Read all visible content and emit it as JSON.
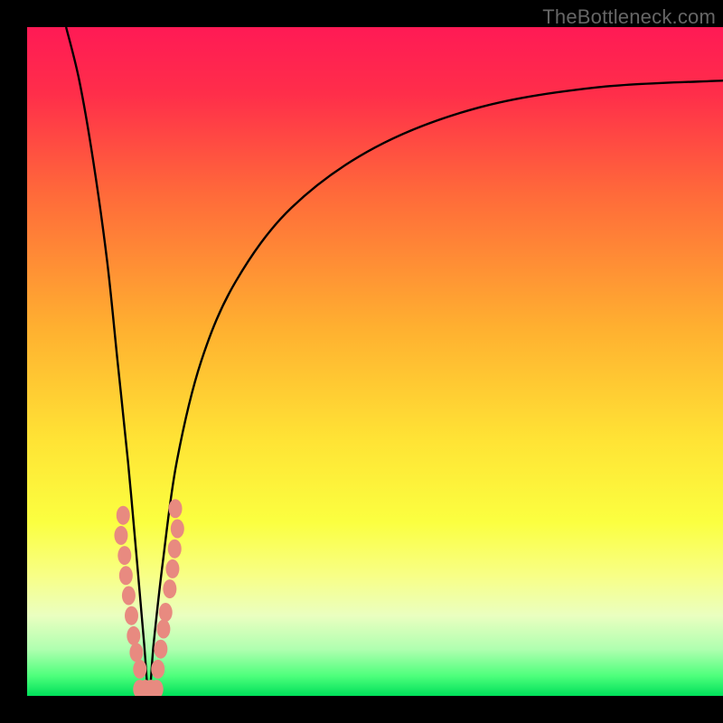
{
  "watermark": "TheBottleneck.com",
  "chart_data": {
    "type": "line",
    "title": "",
    "xlabel": "",
    "ylabel": "",
    "xlim": [
      0,
      100
    ],
    "ylim": [
      0,
      100
    ],
    "gradient_stops": [
      {
        "offset": 0,
        "color": "#ff1a55"
      },
      {
        "offset": 0.1,
        "color": "#ff2e4a"
      },
      {
        "offset": 0.25,
        "color": "#ff6a3a"
      },
      {
        "offset": 0.45,
        "color": "#ffb030"
      },
      {
        "offset": 0.62,
        "color": "#ffe435"
      },
      {
        "offset": 0.74,
        "color": "#fbff40"
      },
      {
        "offset": 0.82,
        "color": "#f8ff86"
      },
      {
        "offset": 0.88,
        "color": "#eaffc0"
      },
      {
        "offset": 0.93,
        "color": "#b0ffb0"
      },
      {
        "offset": 0.97,
        "color": "#4eff7c"
      },
      {
        "offset": 1.0,
        "color": "#00e05a"
      }
    ],
    "curve": {
      "dip_x": 17.5,
      "points": [
        {
          "x": 5.6,
          "y": 100
        },
        {
          "x": 7.5,
          "y": 92
        },
        {
          "x": 9.5,
          "y": 80
        },
        {
          "x": 11.5,
          "y": 65
        },
        {
          "x": 13.0,
          "y": 50
        },
        {
          "x": 14.5,
          "y": 35
        },
        {
          "x": 15.8,
          "y": 20
        },
        {
          "x": 16.8,
          "y": 8
        },
        {
          "x": 17.5,
          "y": 0
        },
        {
          "x": 18.2,
          "y": 8
        },
        {
          "x": 19.5,
          "y": 20
        },
        {
          "x": 21.5,
          "y": 35
        },
        {
          "x": 25.0,
          "y": 50
        },
        {
          "x": 30.0,
          "y": 62
        },
        {
          "x": 38.0,
          "y": 73
        },
        {
          "x": 50.0,
          "y": 82
        },
        {
          "x": 65.0,
          "y": 88
        },
        {
          "x": 82.0,
          "y": 91
        },
        {
          "x": 100.0,
          "y": 92
        }
      ]
    },
    "markers": {
      "color": "#e88a80",
      "points": [
        {
          "x": 13.8,
          "y": 27
        },
        {
          "x": 13.5,
          "y": 24
        },
        {
          "x": 14.0,
          "y": 21
        },
        {
          "x": 14.2,
          "y": 18
        },
        {
          "x": 14.6,
          "y": 15
        },
        {
          "x": 15.0,
          "y": 12
        },
        {
          "x": 15.3,
          "y": 9
        },
        {
          "x": 15.7,
          "y": 6.5
        },
        {
          "x": 16.2,
          "y": 4
        },
        {
          "x": 16.2,
          "y": 1.0
        },
        {
          "x": 17.0,
          "y": 1.0
        },
        {
          "x": 17.8,
          "y": 1.0
        },
        {
          "x": 18.6,
          "y": 1.0
        },
        {
          "x": 18.8,
          "y": 4
        },
        {
          "x": 19.2,
          "y": 7
        },
        {
          "x": 19.6,
          "y": 10
        },
        {
          "x": 19.9,
          "y": 12.5
        },
        {
          "x": 20.5,
          "y": 16
        },
        {
          "x": 20.9,
          "y": 19
        },
        {
          "x": 21.2,
          "y": 22
        },
        {
          "x": 21.6,
          "y": 25
        },
        {
          "x": 21.3,
          "y": 28
        }
      ]
    }
  }
}
